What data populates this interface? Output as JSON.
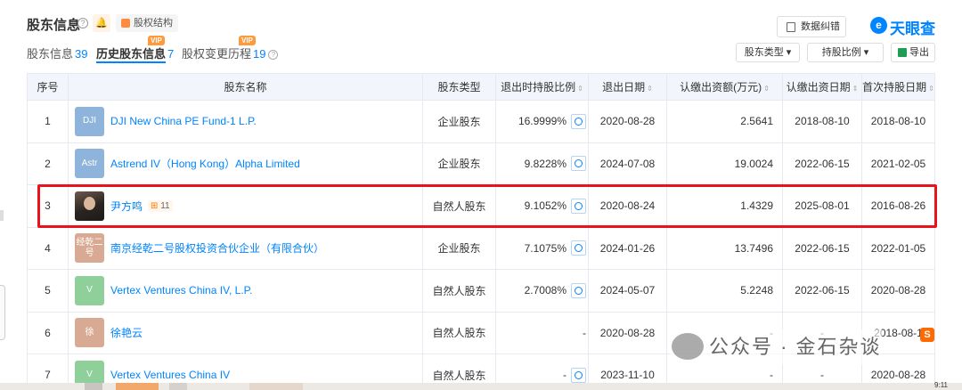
{
  "header": {
    "title": "股东信息",
    "help_glyph": "?",
    "bell_glyph": "🔔",
    "equity_button": "股权结构",
    "error_button": "数据纠错",
    "logo": "天眼查",
    "logo_glyph": "e"
  },
  "tabs": [
    {
      "label": "股东信息",
      "count": "39"
    },
    {
      "label": "历史股东信息",
      "count": "7",
      "vip": "VIP"
    },
    {
      "label": "股权变更历程",
      "count": "19",
      "vip": "VIP",
      "help_glyph": "?"
    }
  ],
  "filters": {
    "shareholder_type": "股东类型 ▾",
    "share_ratio": "持股比例 ▾",
    "export": "导出"
  },
  "table": {
    "headers": {
      "seq": "序号",
      "name": "股东名称",
      "type": "股东类型",
      "ratio": "退出时持股比例",
      "exit_date": "退出日期",
      "capital": "认缴出资额(万元)",
      "capital_date": "认缴出资日期",
      "first_date": "首次持股日期"
    },
    "sort_glyph": "⇕",
    "rows": [
      {
        "seq": "1",
        "avatar": "DJI",
        "avatar_color": "#8fb4db",
        "name": "DJI New China PE Fund-1 L.P.",
        "type": "企业股东",
        "ratio": "16.9999%",
        "exit_date": "2020-08-28",
        "capital": "2.5641",
        "capital_date": "2018-08-10",
        "first_date": "2018-08-10"
      },
      {
        "seq": "2",
        "avatar": "Astr",
        "avatar_color": "#8fb4db",
        "name": "Astrend IV（Hong Kong）Alpha Limited",
        "type": "企业股东",
        "ratio": "9.8228%",
        "exit_date": "2024-07-08",
        "capital": "19.0024",
        "capital_date": "2022-06-15",
        "first_date": "2021-02-05"
      },
      {
        "seq": "3",
        "avatar": "",
        "avatar_color": "#2b2520",
        "name": "尹方鸣",
        "badge": "11",
        "type": "自然人股东",
        "ratio": "9.1052%",
        "exit_date": "2020-08-24",
        "capital": "1.4329",
        "capital_date": "2025-08-01",
        "first_date": "2016-08-26"
      },
      {
        "seq": "4",
        "avatar": "经乾二号",
        "avatar_color": "#d9aa93",
        "name": "南京经乾二号股权投资合伙企业（有限合伙）",
        "type": "企业股东",
        "ratio": "7.1075%",
        "exit_date": "2024-01-26",
        "capital": "13.7496",
        "capital_date": "2022-06-15",
        "first_date": "2022-01-05"
      },
      {
        "seq": "5",
        "avatar": "V",
        "avatar_color": "#8fcf9a",
        "name": "Vertex Ventures China IV, L.P.",
        "type": "自然人股东",
        "ratio": "2.7008%",
        "exit_date": "2024-05-07",
        "capital": "5.2248",
        "capital_date": "2022-06-15",
        "first_date": "2020-08-28"
      },
      {
        "seq": "6",
        "avatar": "徐",
        "avatar_color": "#d9aa93",
        "name": "徐艳云",
        "type": "自然人股东",
        "ratio": "-",
        "exit_date": "2020-08-28",
        "capital": "-",
        "capital_date": "-",
        "first_date": "2018-08-1"
      },
      {
        "seq": "7",
        "avatar": "V",
        "avatar_color": "#8fcf9a",
        "name": "Vertex Ventures China IV",
        "type": "自然人股东",
        "ratio": "-",
        "exit_date": "2023-11-10",
        "capital": "-",
        "capital_date": "-",
        "first_date": "2020-08-28"
      }
    ]
  },
  "watermark": "公众号 · 金石杂谈",
  "corner_badge": "S",
  "clock": "9:11",
  "colors": {
    "accent": "#0084ff",
    "highlight": "#e8141a",
    "vip": "#ff9a3c"
  }
}
